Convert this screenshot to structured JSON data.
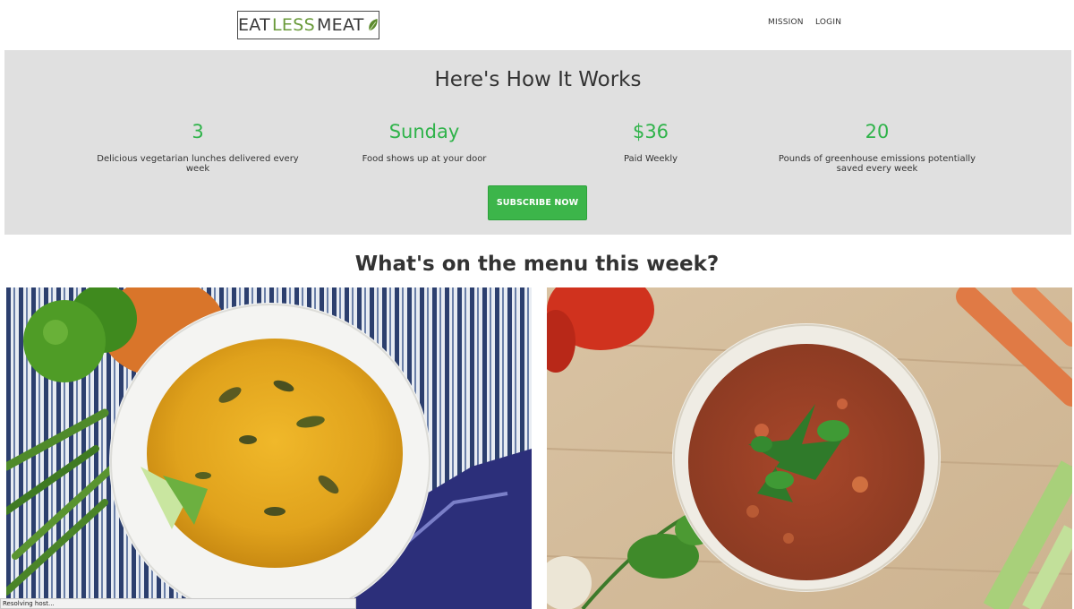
{
  "header": {
    "logo": {
      "part1": "EAT",
      "part2": "LESS",
      "part3": "MEAT"
    },
    "nav": [
      {
        "label": "MISSION"
      },
      {
        "label": "LOGIN"
      }
    ]
  },
  "how_it_works": {
    "title": "Here's How It Works",
    "stats": [
      {
        "value": "3",
        "description": "Delicious vegetarian lunches delivered every week"
      },
      {
        "value": "Sunday",
        "description": "Food shows up at your door"
      },
      {
        "value": "$36",
        "description": "Paid Weekly"
      },
      {
        "value": "20",
        "description": "Pounds of greenhouse emissions potentially saved every week"
      }
    ],
    "cta_label": "SUBSCRIBE NOW"
  },
  "menu": {
    "title": "What's on the menu this week?"
  },
  "status_bar": {
    "text": "Resolving host..."
  },
  "colors": {
    "accent_green": "#2fb34a",
    "button_green": "#3cb54a",
    "band_gray": "#e0e0e0"
  }
}
